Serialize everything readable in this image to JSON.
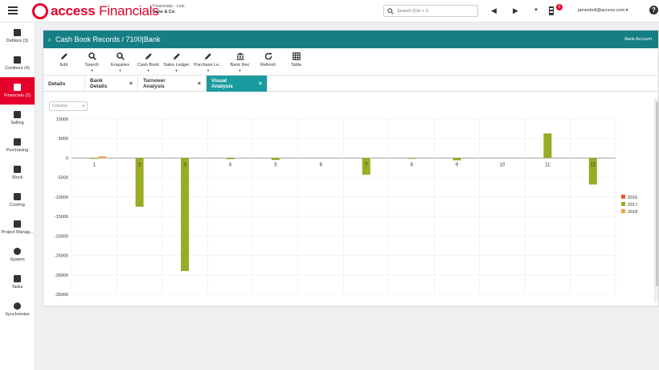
{
  "app": {
    "logo_primary": "access",
    "logo_secondary": "Financials",
    "context_line1": "Financials - Live",
    "context_line2": "Lane & Co"
  },
  "topbar": {
    "search_placeholder": "Search (Ctrl + /)",
    "notification_count": "0",
    "user_email": "jamesbolt@access.com"
  },
  "sidebar": {
    "items": [
      {
        "label": "Debtors (3)"
      },
      {
        "label": "Creditors (4)"
      },
      {
        "label": "Financials (2)"
      },
      {
        "label": "Selling"
      },
      {
        "label": "Purchasing"
      },
      {
        "label": "Stock"
      },
      {
        "label": "Costing"
      },
      {
        "label": "Project Manag..."
      },
      {
        "label": "System"
      },
      {
        "label": "Tasks"
      },
      {
        "label": "Synchronise"
      }
    ]
  },
  "header": {
    "title": "Cash Book Records / 7100|Bank",
    "right_label": "Bank Account"
  },
  "toolbar": {
    "items": [
      {
        "label": "Edit",
        "icon": "pencil-icon"
      },
      {
        "label": "Search",
        "icon": "search-icon"
      },
      {
        "label": "Enquiries",
        "icon": "search-icon"
      },
      {
        "label": "Cash Book",
        "icon": "pencil-icon"
      },
      {
        "label": "Sales Ledger",
        "icon": "pencil-icon"
      },
      {
        "label": "Purchase Le...",
        "icon": "pencil-icon"
      },
      {
        "label": "Bank Rec",
        "icon": "bank-icon"
      },
      {
        "label": "Refresh",
        "icon": "refresh-icon"
      },
      {
        "label": "Table",
        "icon": "table-icon"
      }
    ]
  },
  "tabs": [
    {
      "label": "Details",
      "closable": false
    },
    {
      "label": "Bank Details",
      "closable": true
    },
    {
      "label": "Turnover Analysis",
      "closable": true
    },
    {
      "label": "Visual Analysis",
      "closable": true
    }
  ],
  "chart_controls": {
    "type_select_value": "Column"
  },
  "colors": {
    "accent_red": "#e4002b",
    "teal": "#167f86",
    "tab_active": "#1a9ba0",
    "series_2016": "#e8562a",
    "series_2017": "#9aab24",
    "series_2018": "#f0a13a"
  },
  "chart_data": {
    "type": "bar",
    "categories": [
      "1",
      "2",
      "3",
      "4",
      "5",
      "6",
      "7",
      "8",
      "9",
      "10",
      "11",
      "12"
    ],
    "series": [
      {
        "name": "2016",
        "color": "#e8562a",
        "values": [
          0,
          0,
          0,
          0,
          0,
          0,
          0,
          0,
          0,
          0,
          0,
          0
        ]
      },
      {
        "name": "2017",
        "color": "#9aab24",
        "values": [
          -200,
          -12500,
          -29000,
          -300,
          -500,
          0,
          -4300,
          -100,
          -600,
          0,
          6300,
          -6800
        ]
      },
      {
        "name": "2018",
        "color": "#f0a13a",
        "values": [
          400,
          0,
          0,
          0,
          0,
          0,
          0,
          0,
          0,
          0,
          0,
          0
        ]
      }
    ],
    "yticks": [
      10000,
      5000,
      0,
      -5000,
      -10000,
      -15000,
      -20000,
      -25000,
      -30000,
      -35000
    ],
    "ylim": [
      -35000,
      10000
    ],
    "grid": true,
    "legend_position": "right"
  }
}
